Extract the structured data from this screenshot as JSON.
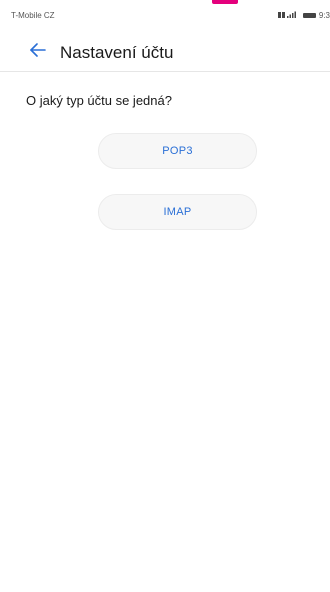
{
  "status_bar": {
    "carrier": "T-Mobile CZ",
    "time": "9:3",
    "signal_icon": "signal-icon",
    "battery_icon": "battery-icon"
  },
  "header": {
    "back_icon": "arrow-left-icon",
    "title": "Nastavení účtu"
  },
  "main": {
    "question": "O jaký typ účtu se jedná?",
    "options": [
      {
        "label": "POP3"
      },
      {
        "label": "IMAP"
      }
    ]
  },
  "colors": {
    "accent": "#2a6fd6",
    "top_marker": "#e4007c"
  }
}
